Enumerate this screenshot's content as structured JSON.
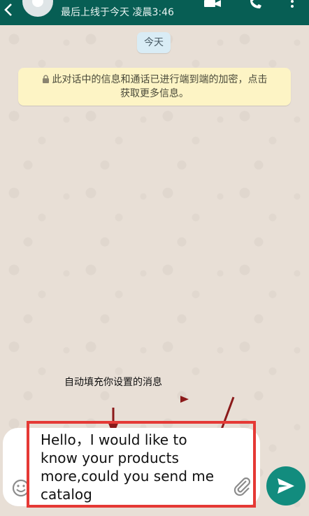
{
  "header": {
    "last_seen": "最后上线于今天 凌晨3:46",
    "icons": [
      "back-arrow-icon",
      "avatar",
      "video-call-icon",
      "voice-call-icon",
      "more-options-icon"
    ]
  },
  "chat": {
    "date_chip": "今天",
    "encryption_notice_line1": "此对话中的信息和通话已进行端到端的加密，点击",
    "encryption_notice_line2": "获取更多信息。"
  },
  "annotation": {
    "label": "自动填充你设置的消息",
    "highlight_color": "#e53935",
    "arrow_color": "#8b1a1a"
  },
  "composer": {
    "message_lines": [
      "Hello，I would like to",
      "know your products",
      "more,could you send me",
      "catalog"
    ],
    "send_button_color": "#128c7e"
  },
  "colors": {
    "header_bg": "#075e54",
    "notice_bg": "#fdf4c5",
    "date_chip_bg": "#d9ecf5"
  }
}
